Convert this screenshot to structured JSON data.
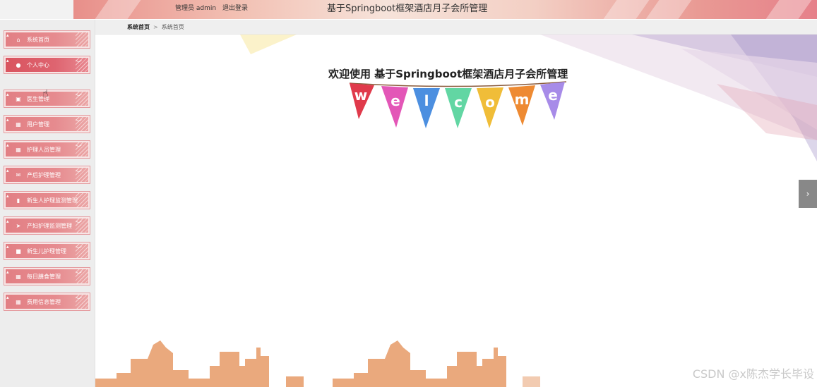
{
  "header": {
    "admin_role": "管理员 admin",
    "logout_label": "退出登录",
    "title": "基于Springboot框架酒店月子会所管理"
  },
  "breadcrumb": {
    "home": "系统首页",
    "separator": ">",
    "current": "系统首页"
  },
  "sidebar": {
    "items": [
      {
        "label": "系统首页",
        "icon": "home-icon"
      },
      {
        "label": "个人中心",
        "icon": "user-icon"
      },
      {
        "label": "医生管理",
        "icon": "doctor-icon"
      },
      {
        "label": "用户管理",
        "icon": "grid-icon"
      },
      {
        "label": "护理人员管理",
        "icon": "grid-icon"
      },
      {
        "label": "产后护理管理",
        "icon": "mail-icon"
      },
      {
        "label": "新生人护理监测管理",
        "icon": "bar-chart-icon"
      },
      {
        "label": "产妇护理监测管理",
        "icon": "send-icon"
      },
      {
        "label": "新生儿护理管理",
        "icon": "briefcase-icon"
      },
      {
        "label": "每日膳食管理",
        "icon": "grid-icon"
      },
      {
        "label": "费用信息管理",
        "icon": "grid-icon"
      }
    ]
  },
  "main": {
    "welcome_title": "欢迎使用 基于Springboot框架酒店月子会所管理",
    "bunting_letters": [
      "w",
      "e",
      "l",
      "c",
      "o",
      "m",
      "e"
    ],
    "bunting_colors": [
      "#e03a4b",
      "#e356b7",
      "#4c8fe0",
      "#62d6a3",
      "#f0bd38",
      "#ee8a32",
      "#a78be8"
    ]
  },
  "side_handle": "›",
  "watermark": "CSDN @x陈杰学长毕设",
  "colors": {
    "menu_item": "#e27f84",
    "menu_item_active": "#d9545f",
    "skyline": "#eaa97d"
  }
}
